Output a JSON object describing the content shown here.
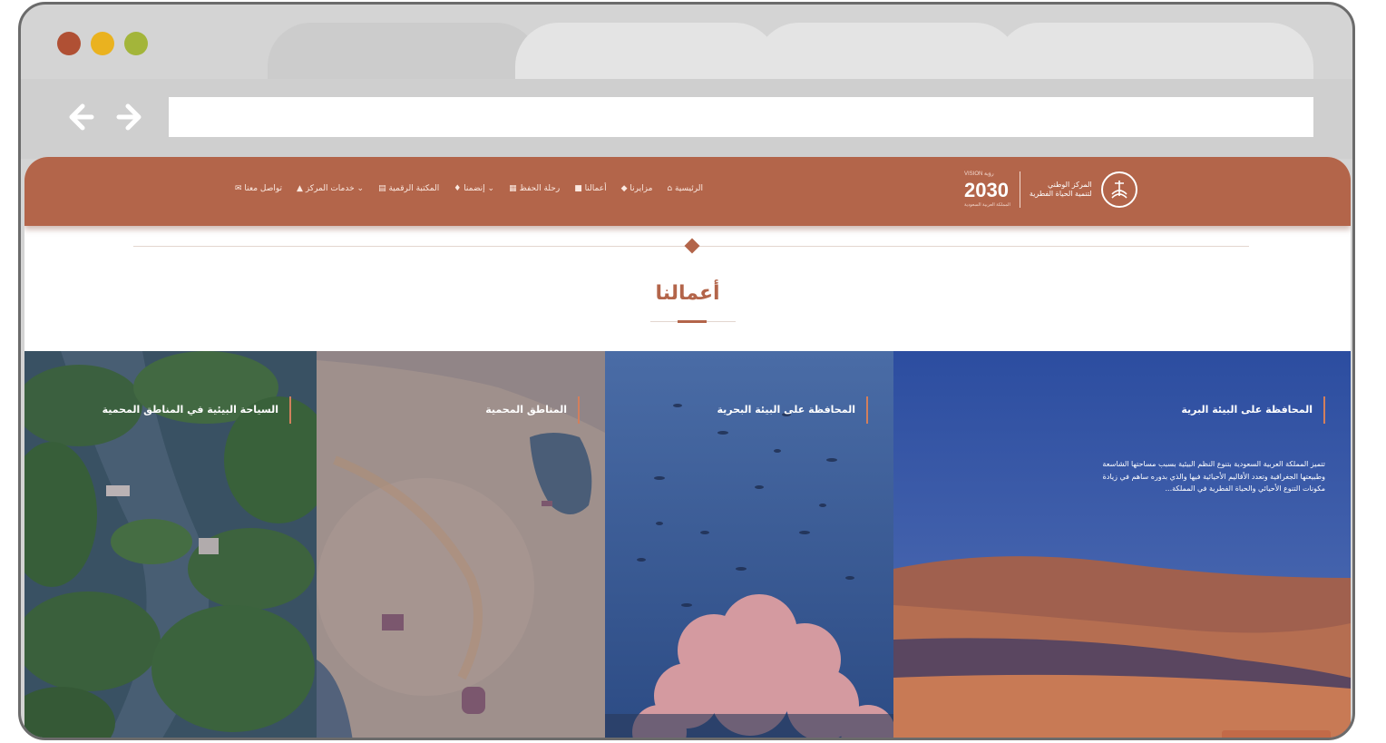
{
  "site": {
    "nav": [
      {
        "label": "الرئيسية",
        "icon": "home-icon"
      },
      {
        "label": "مزايرنا",
        "icon": "diamond-icon"
      },
      {
        "label": "أعمالنا",
        "icon": "square-icon"
      },
      {
        "label": "رحلة الحفظ",
        "icon": "grid-icon"
      },
      {
        "label": "إنضمنا",
        "icon": "pin-icon"
      },
      {
        "label": "المكتبة الرقمية",
        "icon": "book-icon"
      },
      {
        "label": "خدمات المركز",
        "icon": "services-icon"
      },
      {
        "label": "تواصل معنا",
        "icon": "contact-icon"
      }
    ],
    "logo_2030": {
      "top": "VISION رؤية",
      "number": "2030",
      "bottom": "المملكة العربية السعودية"
    },
    "logo_ncw": {
      "line1": "المركز الوطني",
      "line2": "لتنمية الحياة الفطرية"
    }
  },
  "section": {
    "title": "أعمالنا"
  },
  "cards": [
    {
      "title": "السياحة البيئية في المناطق المحمية"
    },
    {
      "title": "المناطق المحمية"
    },
    {
      "title": "المحافظة على البيئة البحرية"
    },
    {
      "title": "المحافظة على البيئة البرية",
      "body": "تتميز المملكة العربية السعودية بتنوع النظم البيئية بسبب مساحتها الشاسعة وطبيعتها الجغرافية وتعدد الأقاليم الأحيائية فيها والذي بدوره ساهم في زيادة مكونات التنوع الأحيائي والحياة الفطرية في المملكة..."
    }
  ],
  "colors": {
    "brand": "#b3654a",
    "dot_red": "#b05034",
    "dot_yellow": "#eab21f",
    "dot_green": "#a3b53a"
  }
}
